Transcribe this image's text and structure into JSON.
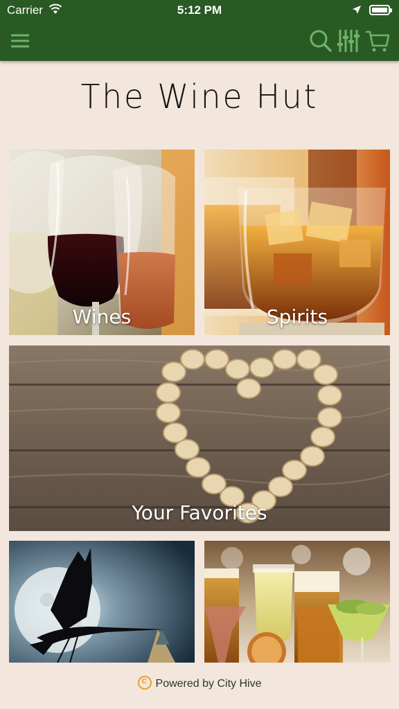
{
  "status_bar": {
    "carrier": "Carrier",
    "time": "5:12 PM"
  },
  "navbar": {
    "menu_icon": "hamburger-icon",
    "search_icon": "search-icon",
    "filter_icon": "filter-icon",
    "cart_icon": "cart-icon",
    "icon_color": "#6fb36a",
    "background": "#2a5a24"
  },
  "store": {
    "title": "The Wine Hut"
  },
  "tiles": [
    {
      "label": "Wines"
    },
    {
      "label": "Spirits"
    },
    {
      "label": "Your Favorites"
    },
    {
      "label": ""
    },
    {
      "label": ""
    }
  ],
  "footer": {
    "text": "Powered by City Hive"
  }
}
